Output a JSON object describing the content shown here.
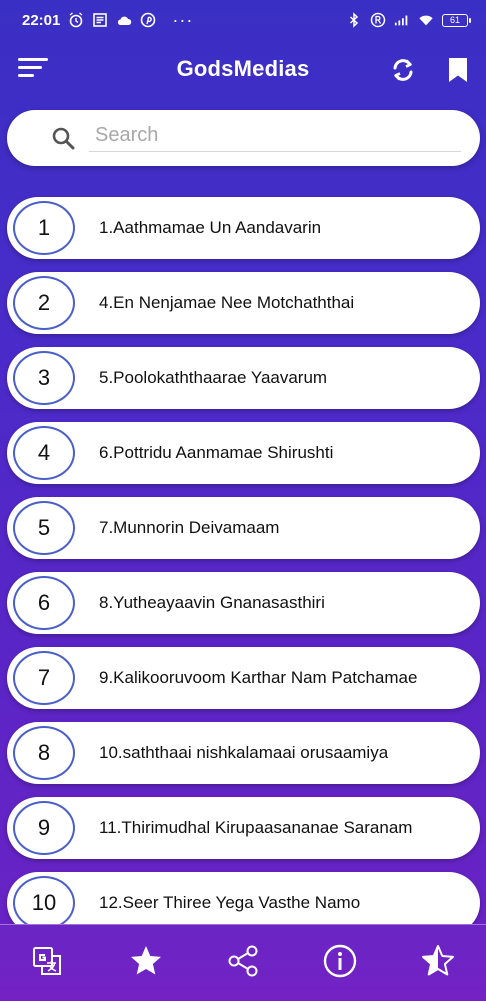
{
  "status_bar": {
    "time": "22:01",
    "dots": "···",
    "battery": "61"
  },
  "app_bar": {
    "title": "GodsMedias"
  },
  "search": {
    "placeholder": "Search"
  },
  "songs": [
    {
      "num": "1",
      "title": "1.Aathmamae Un Aandavarin"
    },
    {
      "num": "2",
      "title": "4.En Nenjamae Nee Motchaththai"
    },
    {
      "num": "3",
      "title": "5.Poolokaththaarae Yaavarum"
    },
    {
      "num": "4",
      "title": "6.Pottridu Aanmamae Shirushti"
    },
    {
      "num": "5",
      "title": "7.Munnorin Deivamaam"
    },
    {
      "num": "6",
      "title": "8.Yutheayaavin Gnanasasthiri"
    },
    {
      "num": "7",
      "title": "9.Kalikooruvoom Karthar Nam Patchamae"
    },
    {
      "num": "8",
      "title": "10.saththaai nishkalamaai orusaamiya"
    },
    {
      "num": "9",
      "title": "11.Thirimudhal Kirupaasananae Saranam"
    },
    {
      "num": "10",
      "title": "12.Seer Thiree Yega Vasthe Namo"
    }
  ],
  "bottom_nav": {
    "items": [
      "translate-icon",
      "star-icon",
      "share-icon",
      "info-icon",
      "rate-star-icon"
    ]
  },
  "colors": {
    "accent_ring": "#4a5fc9",
    "background_top": "#3a2fc4",
    "background_bottom": "#6c22c4"
  }
}
